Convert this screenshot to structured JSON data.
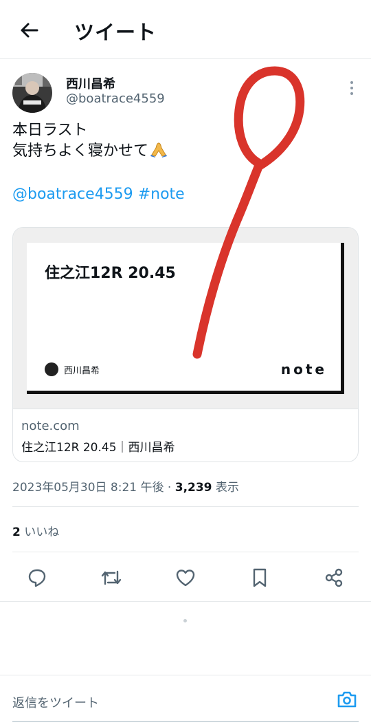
{
  "header": {
    "title": "ツイート",
    "back_icon": "arrow-left-icon"
  },
  "author": {
    "name": "西川昌希",
    "handle": "@boatrace4559"
  },
  "tweet": {
    "line1": "本日ラスト",
    "line2": "気持ちよく寝かせて",
    "emoji": "folded-hands-icon",
    "mention": "@boatrace4559",
    "hashtag": "#note"
  },
  "card": {
    "image_title": "住之江12R 20.45",
    "image_author": "西川昌希",
    "image_logo": "note",
    "domain": "note.com",
    "description": "住之江12R 20.45｜西川昌希"
  },
  "meta": {
    "datetime": "2023年05月30日 8:21 午後 · ",
    "views_count": "3,239",
    "views_label": " 表示"
  },
  "likes": {
    "count": "2",
    "label": " いいね"
  },
  "actions": [
    "reply-icon",
    "retweet-icon",
    "like-icon",
    "bookmark-icon",
    "share-icon"
  ],
  "reply": {
    "placeholder": "返信をツイート",
    "camera_icon": "camera-icon"
  },
  "colors": {
    "link": "#1d9bf0",
    "muted": "#536471",
    "scribble": "#d9342b"
  }
}
